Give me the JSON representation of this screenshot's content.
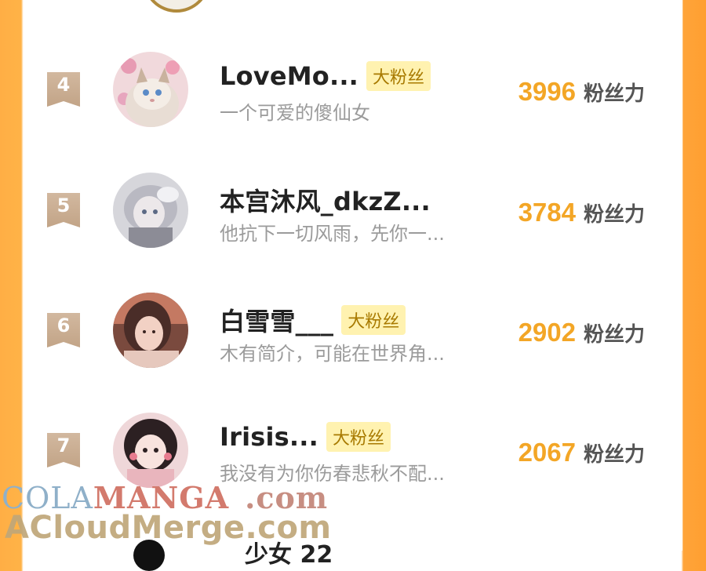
{
  "colors": {
    "accent_orange": "#ffa43a",
    "score_color": "#f3a626",
    "badge_bg": "#fff2b0",
    "badge_text": "#a87a00",
    "rank_ribbon": "#c8aa8c"
  },
  "rows": [
    {
      "rank": "4",
      "name": "LoveMo...",
      "badge": "大粉丝",
      "bio": "一个可爱的傻仙女",
      "score": "3996",
      "score_unit": "粉丝力",
      "avatar_icon": "cat-avatar"
    },
    {
      "rank": "5",
      "name": "本宫沐风_dkzZ...",
      "badge": "",
      "bio": "他抗下一切风雨，先你一...",
      "score": "3784",
      "score_unit": "粉丝力",
      "avatar_icon": "anime-girl-avatar"
    },
    {
      "rank": "6",
      "name": "白雪雪___",
      "badge": "大粉丝",
      "bio": "木有简介，可能在世界角...",
      "score": "2902",
      "score_unit": "粉丝力",
      "avatar_icon": "girl-photo-avatar"
    },
    {
      "rank": "7",
      "name": "Irisis...",
      "badge": "大粉丝",
      "bio": "我没有为你伤春悲秋不配...",
      "score": "2067",
      "score_unit": "粉丝力",
      "avatar_icon": "girl-pink-avatar"
    }
  ],
  "next_row_partial": {
    "name": "少女 22"
  },
  "watermark": {
    "line1_a": "COLA",
    "line1_b": "MANGA",
    "line1_c": ".com",
    "line2": "ACloudMerge.com"
  }
}
